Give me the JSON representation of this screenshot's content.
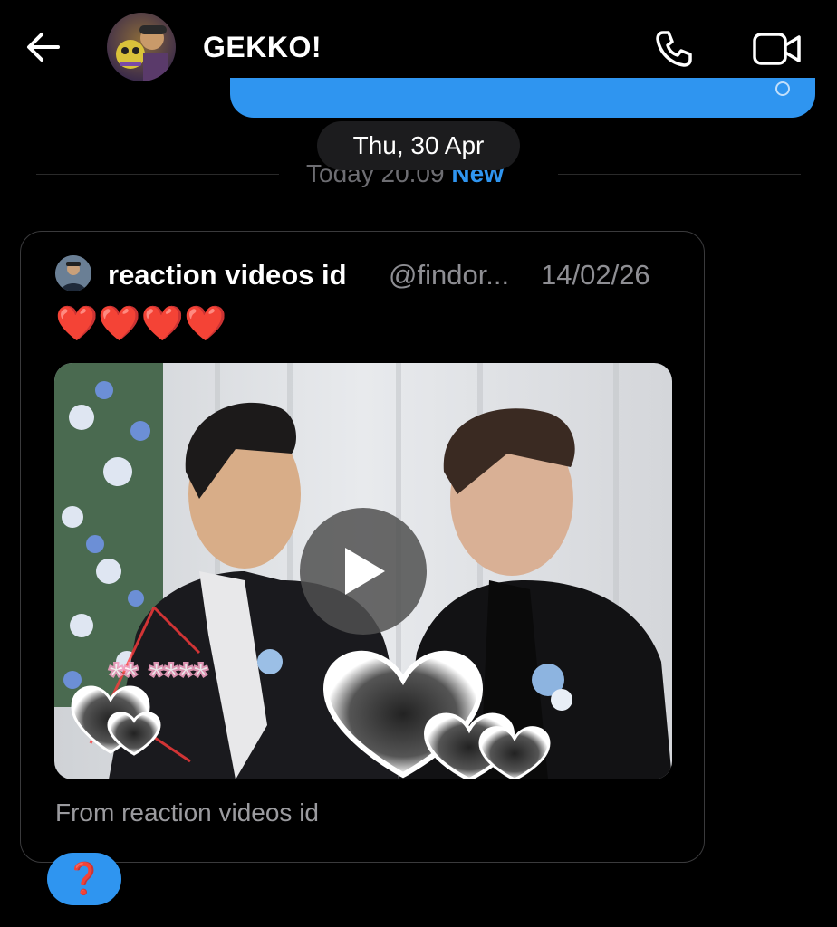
{
  "header": {
    "title": "GEKKO!",
    "back_icon": "arrow-left-icon",
    "phone_icon": "phone-icon",
    "video_icon": "video-camera-icon"
  },
  "divider": {
    "date_pill": "Thu, 30 Apr",
    "today_label": "Today 20.09",
    "new_label": "New"
  },
  "shared_post": {
    "author": "reaction videos id",
    "handle": "@findor...",
    "date": "14/02/26",
    "text": "❤️❤️❤️❤️",
    "play_icon": "play-icon",
    "source": "From reaction videos id"
  },
  "reaction": {
    "label": "❓"
  },
  "colors": {
    "accent": "#2f95f0",
    "background": "#000000",
    "card_border": "#3a3a3c",
    "muted_text": "#8e8e93"
  }
}
